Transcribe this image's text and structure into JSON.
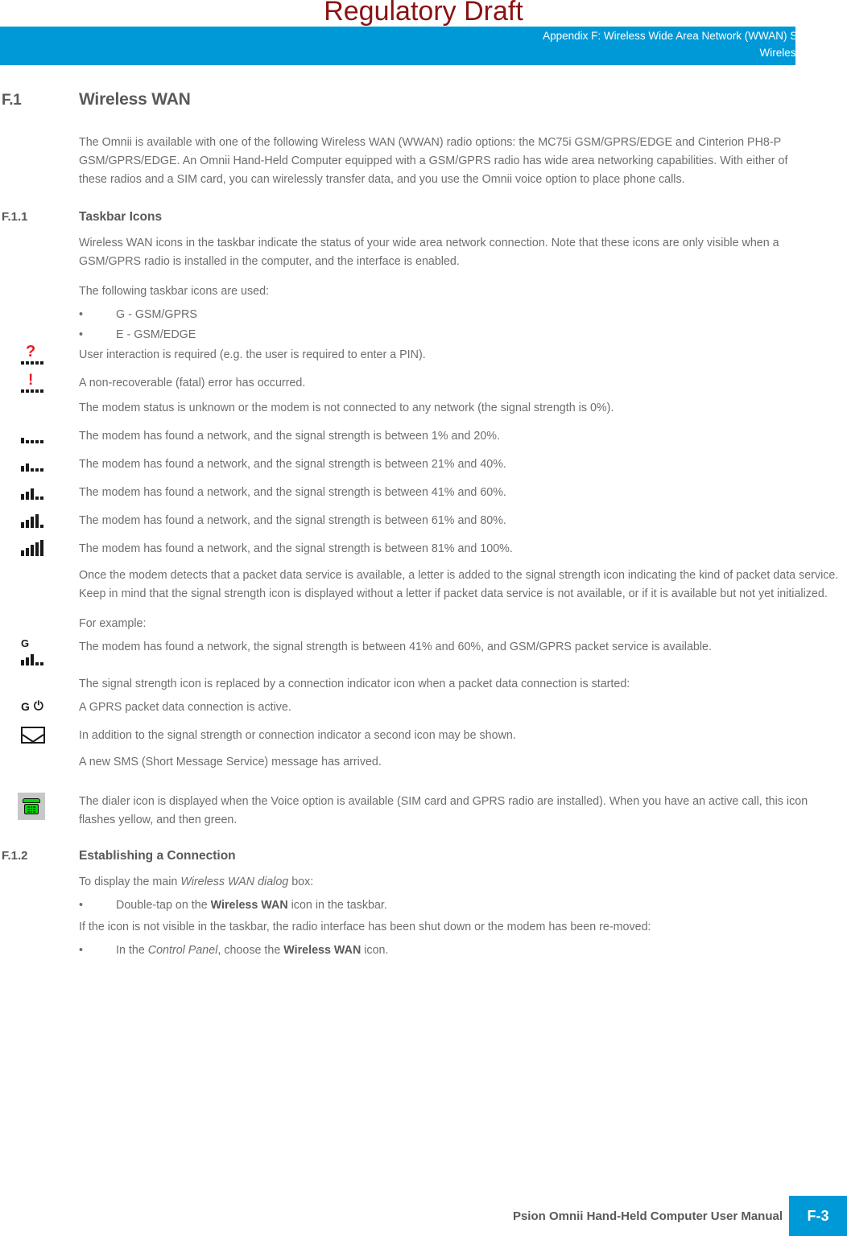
{
  "watermark": "Regulatory Draft",
  "header": {
    "line1": "Appendix F: Wireless Wide Area Network (WWAN) Settings",
    "line2": "Wireless WAN",
    "bg_color": "#0099D8"
  },
  "sections": {
    "f1": {
      "number": "F.1",
      "title": "Wireless WAN",
      "intro": "The Omnii is available with one of the following Wireless WAN (WWAN) radio options: the MC75i GSM/GPRS/EDGE and Cinterion PH8-P GSM/GPRS/EDGE. An Omnii Hand-Held Computer equipped with a GSM/GPRS radio has wide area networking capabilities. With either of these radios and a SIM card, you can wirelessly transfer data, and you use the Omnii voice option to place phone calls."
    },
    "f11": {
      "number": "F.1.1",
      "title": "Taskbar Icons",
      "p1": "Wireless WAN icons in the taskbar indicate the status of your wide area network connection. Note that these icons are only visible when a GSM/GPRS radio is installed in the computer, and the interface is enabled.",
      "p2": "The following taskbar icons are used:",
      "bullets": [
        {
          "marker": "•",
          "text": "G - GSM/GPRS"
        },
        {
          "marker": "•",
          "text": "E  - GSM/EDGE"
        }
      ],
      "icon_rows": [
        {
          "icon": "question-dots-icon",
          "text": "User interaction is required (e.g. the user is required to enter a PIN)."
        },
        {
          "icon": "exclamation-dots-icon",
          "text": "A non-recoverable (fatal) error has occurred."
        },
        {
          "icon": "signal-0-icon",
          "text": "The modem status is unknown or the modem is not connected to any network (the signal strength is 0%)."
        },
        {
          "icon": "signal-1-icon",
          "text": "The modem has found a network, and the signal strength is between 1% and 20%."
        },
        {
          "icon": "signal-2-icon",
          "text": "The modem has found a network, and the signal strength is between 21% and 40%."
        },
        {
          "icon": "signal-3-icon",
          "text": "The modem has found a network, and the signal strength is between 41% and 60%."
        },
        {
          "icon": "signal-4-icon",
          "text": "The modem has found a network, and the signal strength is between 61% and 80%."
        },
        {
          "icon": "signal-5-icon",
          "text": "The modem has found a network, and the signal strength is between 81% and 100%."
        }
      ],
      "p3": "Once the modem detects that a packet data service is available, a letter is added to the signal strength icon indicating the kind of packet data service. Keep in mind that the signal strength icon is displayed without a letter if packet data service is not available, or if it is available but not yet initialized.",
      "p4": "For example:",
      "icon_rows2": [
        {
          "icon": "gsm-gprs-signal-icon",
          "letter": "G",
          "text": "The modem has found a network, the signal strength is between 41% and 60%, and GSM/GPRS packet service is available."
        }
      ],
      "p5": "The signal strength icon is replaced by a connection indicator icon when a packet data connection is started:",
      "icon_rows3": [
        {
          "icon": "gprs-active-icon",
          "letter": "G",
          "text": "A GPRS packet data connection is active."
        },
        {
          "icon": "envelope-icon",
          "text": "In addition to the signal strength or connection indicator a second icon may be shown."
        }
      ],
      "p6": "A new SMS (Short Message Service) message has arrived.",
      "icon_rows4": [
        {
          "icon": "dialer-phone-icon",
          "text": "The dialer icon is displayed when the Voice option is available (SIM card and GPRS radio are installed). When you have an active call, this icon flashes yellow, and then green."
        }
      ]
    },
    "f12": {
      "number": "F.1.2",
      "title": "Establishing a Connection",
      "p1_prefix": "To display the main ",
      "p1_italic": "Wireless WAN dialog",
      "p1_suffix": " box:",
      "bullet1_prefix": "Double-tap on the ",
      "bullet1_bold": "Wireless WAN",
      "bullet1_suffix": " icon in the taskbar.",
      "p2": "If the icon is not visible in the taskbar, the radio interface has been shut down or the modem has been re-moved:",
      "bullet2_prefix": "In the ",
      "bullet2_italic": "Control Panel",
      "bullet2_mid": ", choose the ",
      "bullet2_bold": "Wireless WAN",
      "bullet2_suffix": " icon.",
      "marker": "•"
    }
  },
  "footer": {
    "manual_title": "Psion Omnii Hand-Held Computer User Manual",
    "page_number": "F-3",
    "page_bg_color": "#0099D8"
  }
}
